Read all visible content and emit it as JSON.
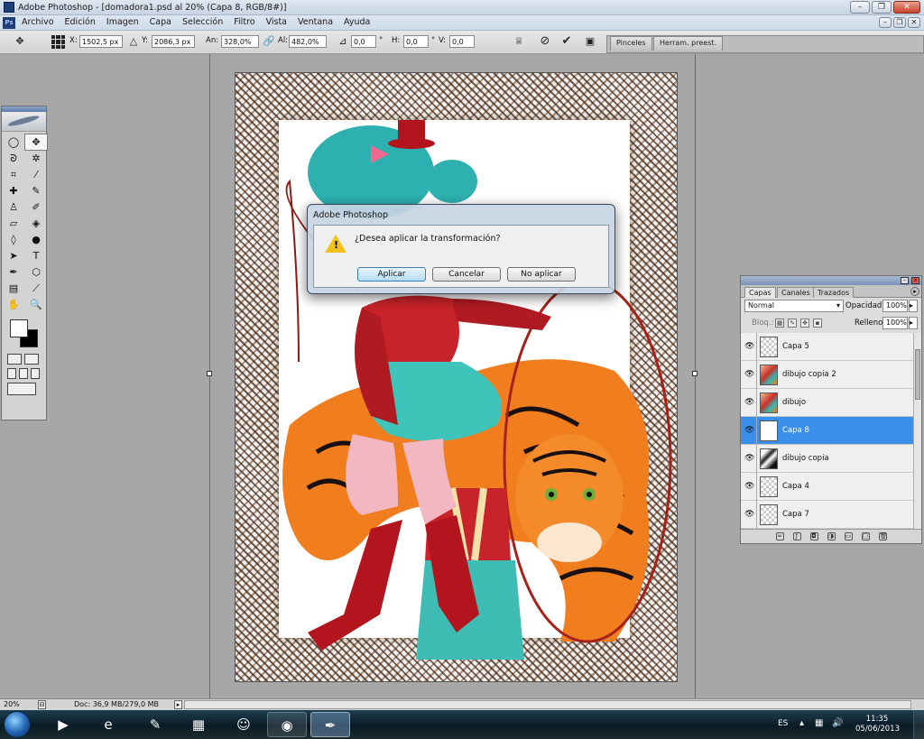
{
  "window": {
    "title": "Adobe Photoshop - [domadora1.psd al 20% (Capa 8, RGB/8#)]",
    "min_glyph": "–",
    "max_glyph": "❐",
    "close_glyph": "✕"
  },
  "menu": {
    "items": [
      "Archivo",
      "Edición",
      "Imagen",
      "Capa",
      "Selección",
      "Filtro",
      "Vista",
      "Ventana",
      "Ayuda"
    ]
  },
  "options": {
    "x_label": "X:",
    "x_value": "1502,5 px",
    "y_label": "Y:",
    "y_value": "2086,3 px",
    "w_label": "An:",
    "w_value": "328,0%",
    "h_label": "Al:",
    "h_value": "482,0%",
    "rot_value": "0,0",
    "rot_unit": "°",
    "hskew_label": "H:",
    "hskew_value": "0,0",
    "hskew_unit": "°",
    "vskew_label": "V:",
    "vskew_value": "0,0",
    "tabs": [
      "Pinceles",
      "Herram. preest."
    ]
  },
  "dialog": {
    "title": "Adobe Photoshop",
    "message": "¿Desea aplicar la transformación?",
    "buttons": {
      "apply": "Aplicar",
      "cancel": "Cancelar",
      "dont_apply": "No aplicar"
    }
  },
  "toolbox": {
    "tools": [
      {
        "name": "marquee-tool-icon",
        "glyph": "◯"
      },
      {
        "name": "move-tool-icon",
        "glyph": "✥",
        "selected": true
      },
      {
        "name": "lasso-tool-icon",
        "glyph": "ᘐ"
      },
      {
        "name": "magic-wand-icon",
        "glyph": "✲"
      },
      {
        "name": "crop-tool-icon",
        "glyph": "⌗"
      },
      {
        "name": "eyedropper-icon",
        "glyph": "⁄"
      },
      {
        "name": "healing-brush-icon",
        "glyph": "✚"
      },
      {
        "name": "brush-tool-icon",
        "glyph": "✎"
      },
      {
        "name": "clone-stamp-icon",
        "glyph": "♙"
      },
      {
        "name": "history-brush-icon",
        "glyph": "✐"
      },
      {
        "name": "eraser-tool-icon",
        "glyph": "▱"
      },
      {
        "name": "paint-bucket-icon",
        "glyph": "◈"
      },
      {
        "name": "blur-tool-icon",
        "glyph": "◊"
      },
      {
        "name": "dodge-tool-icon",
        "glyph": "●"
      },
      {
        "name": "path-select-icon",
        "glyph": "➤"
      },
      {
        "name": "type-tool-icon",
        "glyph": "T"
      },
      {
        "name": "pen-tool-icon",
        "glyph": "✒"
      },
      {
        "name": "shape-tool-icon",
        "glyph": "⬡"
      },
      {
        "name": "notes-tool-icon",
        "glyph": "▤"
      },
      {
        "name": "measure-eyedropper-icon",
        "glyph": "⟋"
      },
      {
        "name": "hand-tool-icon",
        "glyph": "✋"
      },
      {
        "name": "zoom-tool-icon",
        "glyph": "🔍"
      }
    ]
  },
  "layers_panel": {
    "tabs": [
      "Capas",
      "Canales",
      "Trazados"
    ],
    "blend_mode": "Normal",
    "opacity_label": "Opacidad:",
    "opacity_value": "100%",
    "lock_label": "Bloq.:",
    "fill_label": "Relleno:",
    "fill_value": "100%",
    "layers": [
      {
        "name": "Capa 5",
        "thumb": "checker",
        "active": false
      },
      {
        "name": "dibujo copia 2",
        "thumb": "art",
        "active": false
      },
      {
        "name": "dibujo",
        "thumb": "art",
        "active": false
      },
      {
        "name": "Capa 8",
        "thumb": "white",
        "active": true
      },
      {
        "name": "dibujo copia",
        "thumb": "dark",
        "active": false
      },
      {
        "name": "Capa 4",
        "thumb": "checker",
        "active": false
      },
      {
        "name": "Capa 7",
        "thumb": "checker",
        "active": false
      }
    ]
  },
  "status": {
    "zoom": "20%",
    "doc": "Doc: 36,9 MB/279,0 MB"
  },
  "taskbar": {
    "apps": [
      {
        "name": "media-player-app",
        "glyph": "▶"
      },
      {
        "name": "internet-explorer-app",
        "glyph": "e"
      },
      {
        "name": "paint-app",
        "glyph": "✎"
      },
      {
        "name": "explorer-app",
        "glyph": "▦"
      },
      {
        "name": "messenger-app",
        "glyph": "☺"
      },
      {
        "name": "chrome-app",
        "glyph": "◉"
      },
      {
        "name": "photoshop-app",
        "glyph": "✒"
      }
    ],
    "lang": "ES",
    "time": "11:35",
    "date": "05/06/2013"
  },
  "colors": {
    "selected_layer": "#3a8fea",
    "dialog_default": "#b3dbf5"
  }
}
